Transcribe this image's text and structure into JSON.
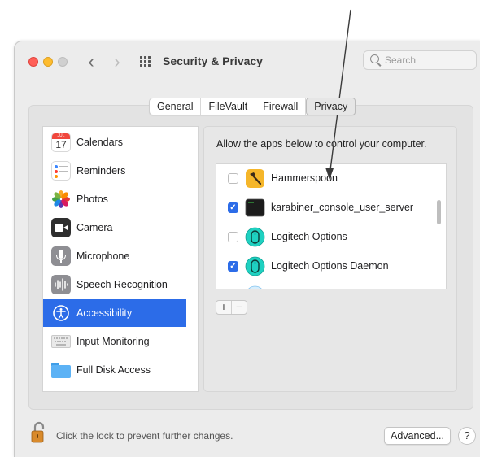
{
  "window": {
    "title": "Security & Privacy",
    "search_placeholder": "Search",
    "back_glyph": "‹",
    "forward_glyph": "›"
  },
  "tabs": [
    {
      "label": "General",
      "active": false
    },
    {
      "label": "FileVault",
      "active": false
    },
    {
      "label": "Firewall",
      "active": false
    },
    {
      "label": "Privacy",
      "active": true
    }
  ],
  "sidebar": {
    "items": [
      {
        "label": "Calendars",
        "icon": "calendar-icon",
        "icon_text": "17",
        "icon_month": "JUL",
        "selected": false
      },
      {
        "label": "Reminders",
        "icon": "reminders-icon",
        "selected": false
      },
      {
        "label": "Photos",
        "icon": "photos-icon",
        "selected": false
      },
      {
        "label": "Camera",
        "icon": "camera-icon",
        "selected": false
      },
      {
        "label": "Microphone",
        "icon": "microphone-icon",
        "selected": false
      },
      {
        "label": "Speech Recognition",
        "icon": "speech-recognition-icon",
        "selected": false
      },
      {
        "label": "Accessibility",
        "icon": "accessibility-icon",
        "selected": true
      },
      {
        "label": "Input Monitoring",
        "icon": "keyboard-icon",
        "selected": false
      },
      {
        "label": "Full Disk Access",
        "icon": "folder-icon",
        "selected": false
      }
    ]
  },
  "privacy": {
    "description": "Allow the apps below to control your computer.",
    "apps": [
      {
        "name": "Hammerspoon",
        "checked": false,
        "icon": "hammerspoon-icon"
      },
      {
        "name": "karabiner_console_user_server",
        "checked": true,
        "icon": "terminal-icon"
      },
      {
        "name": "Logitech Options",
        "checked": false,
        "icon": "logitech-mouse-icon"
      },
      {
        "name": "Logitech Options Daemon",
        "checked": true,
        "icon": "logitech-mouse-icon"
      }
    ],
    "add_label": "+",
    "remove_label": "−"
  },
  "footer": {
    "lock_text": "Click the lock to prevent further changes.",
    "advanced_label": "Advanced...",
    "help_label": "?"
  },
  "colors": {
    "selection_blue": "#2c6ce8",
    "close": "#ff5f57",
    "minimize": "#febc2e",
    "logitech_teal": "#1fd1c1"
  }
}
